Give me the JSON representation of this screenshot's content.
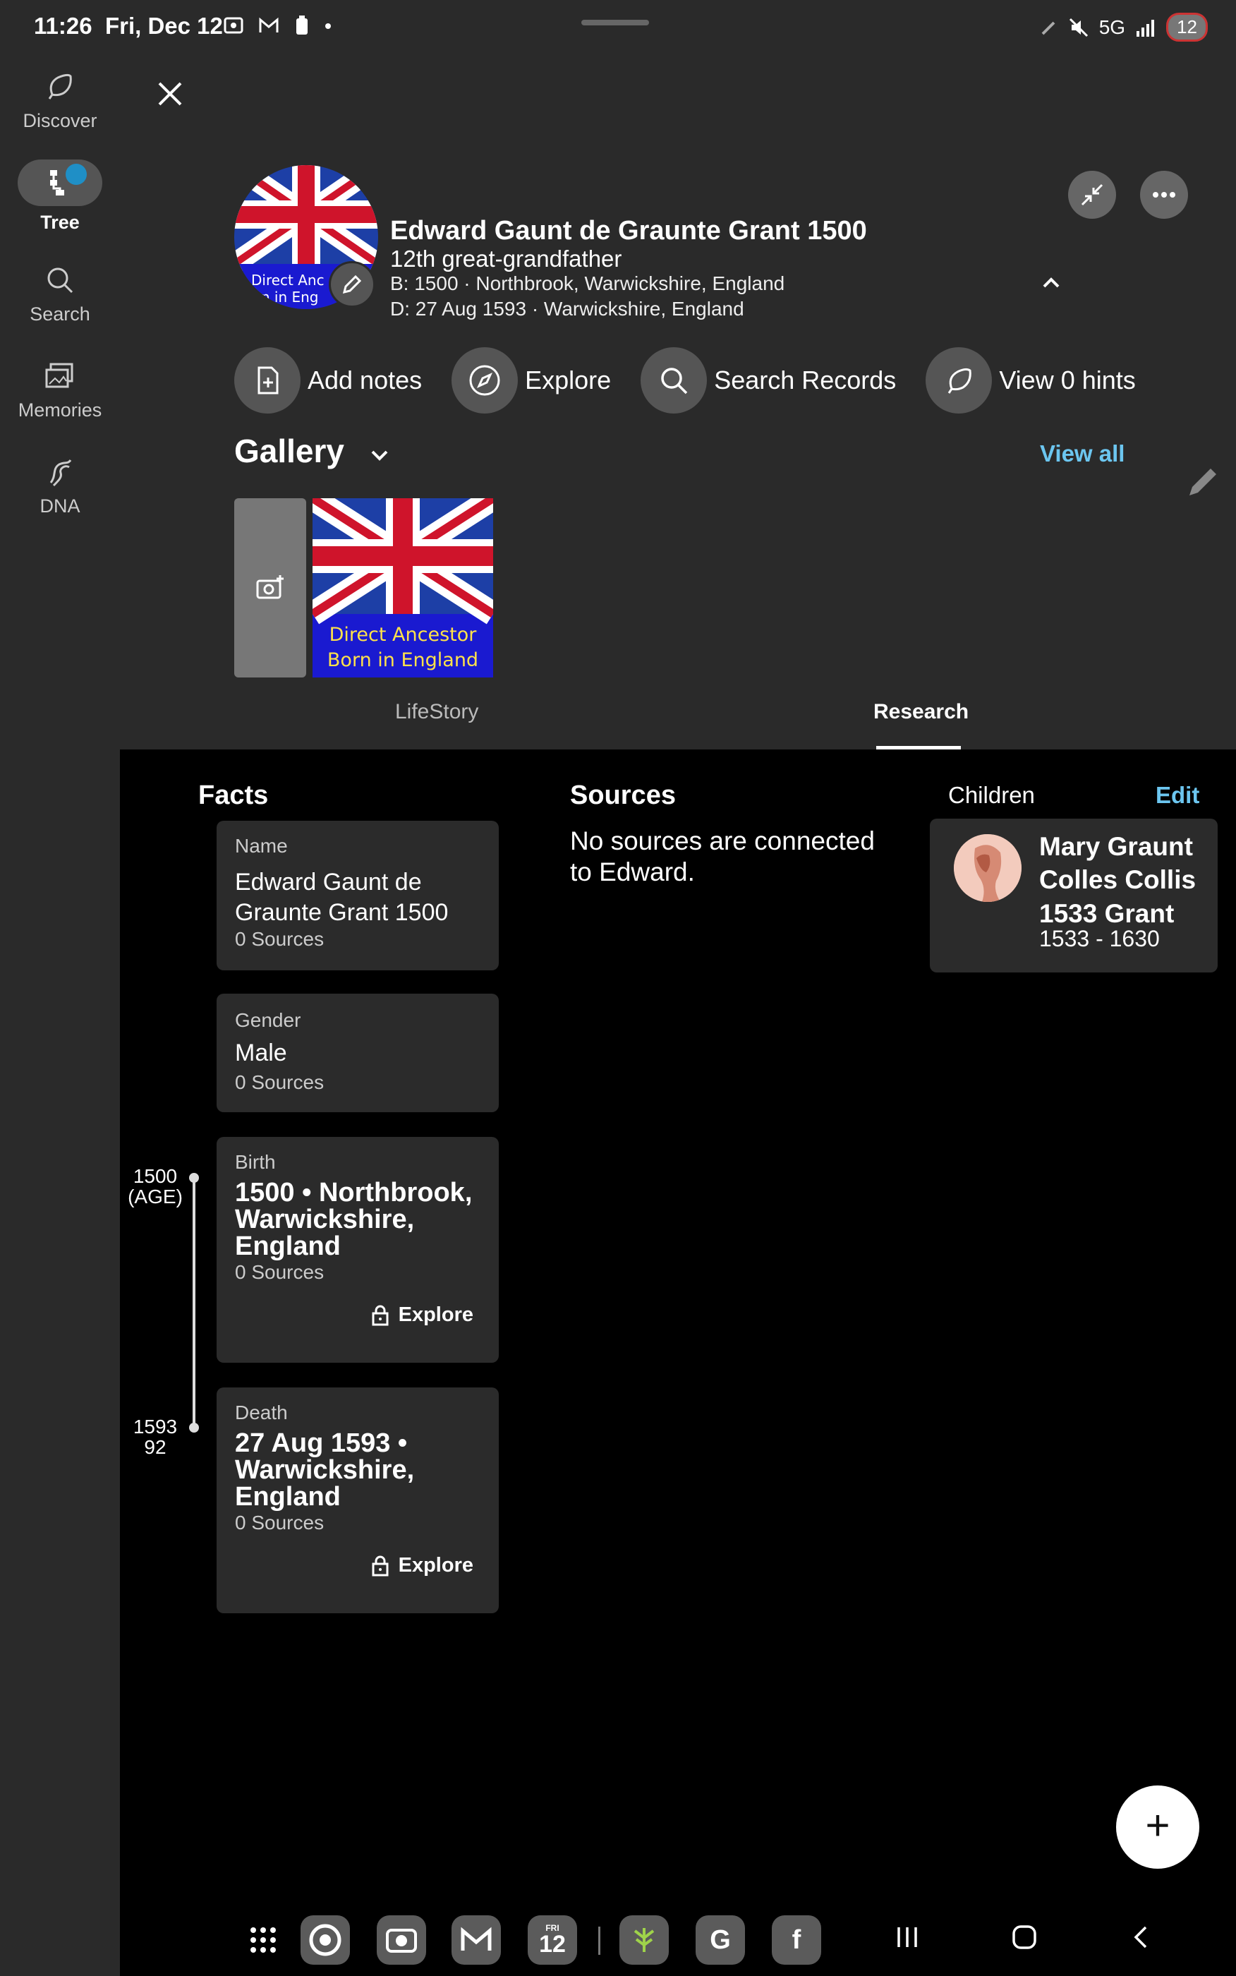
{
  "status_bar": {
    "time": "11:26",
    "date": "Fri, Dec 12",
    "icons": [
      "screenshot-icon",
      "gmail-icon",
      "battery-saver-icon",
      "dot-icon"
    ],
    "network": "5G",
    "battery": "12"
  },
  "rail": {
    "items": [
      {
        "label": "Discover",
        "icon": "discover-icon"
      },
      {
        "label": "Tree",
        "icon": "tree-icon",
        "active": true
      },
      {
        "label": "Search",
        "icon": "search-icon"
      },
      {
        "label": "Memories",
        "icon": "memories-icon"
      },
      {
        "label": "DNA",
        "icon": "dna-icon"
      }
    ]
  },
  "person": {
    "name": "Edward Gaunt de Graunte Grant 1500",
    "relation": "12th great-grandfather",
    "birth": "B: 1500 · Northbrook, Warwickshire, England",
    "death": "D: 27 Aug 1593 · Warwickshire, England",
    "avatar_caption_1": "Direct Anc",
    "avatar_caption_2": "rn in Eng"
  },
  "actions": [
    {
      "label": "Add notes",
      "icon": "add-note-icon"
    },
    {
      "label": "Explore",
      "icon": "compass-icon"
    },
    {
      "label": "Search Records",
      "icon": "search-icon"
    },
    {
      "label": "View 0 hints",
      "icon": "hint-leaf-icon"
    }
  ],
  "gallery": {
    "title": "Gallery",
    "view_all": "View all",
    "thumb_line_1": "Direct Ancestor",
    "thumb_line_2": "Born in England"
  },
  "tabs": {
    "lifestory": "LifeStory",
    "research": "Research",
    "active": "research"
  },
  "facts": {
    "title": "Facts",
    "name": {
      "label": "Name",
      "value": "Edward Gaunt de Graunte Grant 1500",
      "sources": "0 Sources"
    },
    "gender": {
      "label": "Gender",
      "value": "Male",
      "sources": "0 Sources"
    },
    "birth": {
      "label": "Birth",
      "value": "1500 • Northbrook, Warwickshire, England",
      "sources": "0 Sources",
      "explore": "Explore"
    },
    "death": {
      "label": "Death",
      "value": "27 Aug 1593 • Warwickshire, England",
      "sources": "0 Sources",
      "explore": "Explore"
    }
  },
  "timeline": {
    "birth_year": "1500",
    "birth_age": "(AGE)",
    "death_year": "1593",
    "death_age": "92"
  },
  "sources": {
    "title": "Sources",
    "empty": "No sources are connected to Edward."
  },
  "children": {
    "title": "Children",
    "edit": "Edit",
    "items": [
      {
        "name": "Mary Graunt Colles Collis 1533 Grant",
        "years": "1533 - 1630"
      }
    ]
  },
  "fab": "+",
  "dock": {
    "apps": [
      "all-apps-icon",
      "chrome-icon",
      "camera-icon",
      "gmail-icon",
      "calendar-icon",
      "ancestry-icon",
      "google-icon",
      "facebook-icon"
    ],
    "calendar_day": "12",
    "calendar_weekday": "FRI",
    "google_letter": "G",
    "facebook_letter": "f"
  },
  "colors": {
    "accent_link": "#6cc6f0",
    "badge_blue": "#1f8fc6",
    "surface": "#2a2a2a",
    "card": "#2b2b2b"
  }
}
